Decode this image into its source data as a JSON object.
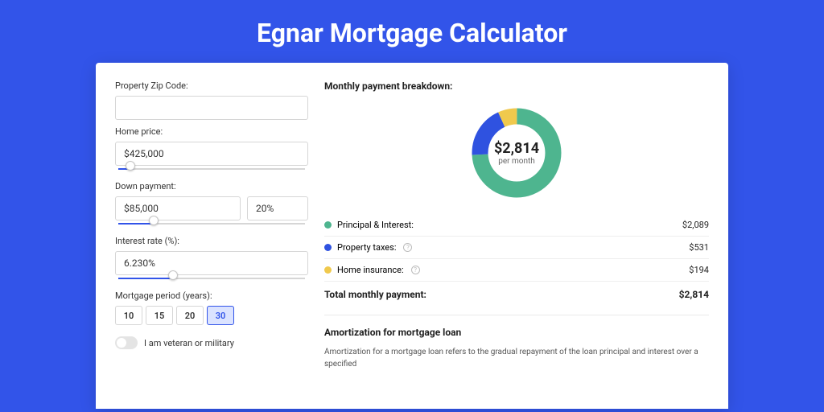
{
  "title": "Egnar Mortgage Calculator",
  "form": {
    "zip": {
      "label": "Property Zip Code:",
      "value": ""
    },
    "home_price": {
      "label": "Home price:",
      "value": "$425,000",
      "slider_pct": 8
    },
    "down_payment": {
      "label": "Down payment:",
      "amount": "$85,000",
      "percent": "20%",
      "slider_pct": 20
    },
    "interest": {
      "label": "Interest rate (%):",
      "value": "6.230%",
      "slider_pct": 30
    },
    "period": {
      "label": "Mortgage period (years):",
      "options": [
        "10",
        "15",
        "20",
        "30"
      ],
      "selected": "30"
    },
    "veteran": {
      "label": "I am veteran or military",
      "checked": false
    }
  },
  "breakdown": {
    "title": "Monthly payment breakdown:",
    "center_value": "$2,814",
    "center_label": "per month",
    "items": [
      {
        "label": "Principal & Interest:",
        "value": "$2,089",
        "color": "#4eb58f",
        "info": false,
        "share": 0.742
      },
      {
        "label": "Property taxes:",
        "value": "$531",
        "color": "#2f52e0",
        "info": true,
        "share": 0.189
      },
      {
        "label": "Home insurance:",
        "value": "$194",
        "color": "#f0c94d",
        "info": true,
        "share": 0.069
      }
    ],
    "total_label": "Total monthly payment:",
    "total_value": "$2,814"
  },
  "amortization": {
    "title": "Amortization for mortgage loan",
    "text": "Amortization for a mortgage loan refers to the gradual repayment of the loan principal and interest over a specified"
  },
  "chart_data": {
    "type": "pie",
    "title": "Monthly payment breakdown",
    "series": [
      {
        "name": "Principal & Interest",
        "value": 2089,
        "color": "#4eb58f"
      },
      {
        "name": "Property taxes",
        "value": 531,
        "color": "#2f52e0"
      },
      {
        "name": "Home insurance",
        "value": 194,
        "color": "#f0c94d"
      }
    ],
    "total": 2814,
    "center_label": "$2,814 per month"
  }
}
